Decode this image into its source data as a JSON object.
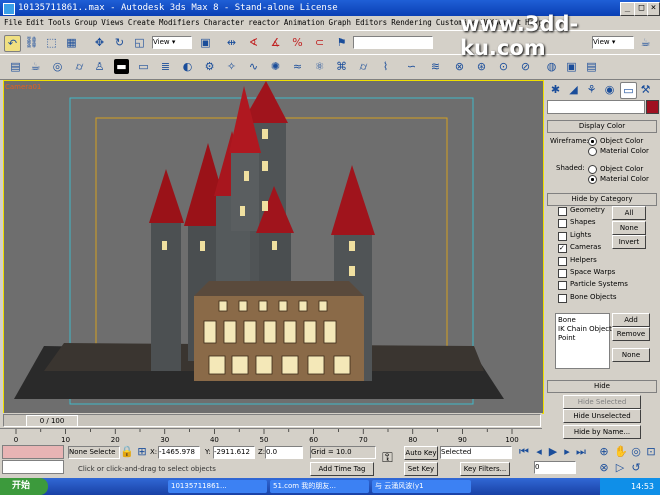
{
  "window": {
    "title": "10135711861..max - Autodesk 3ds Max 8  - Stand-alone License"
  },
  "menu": [
    "File",
    "Edit",
    "Tools",
    "Group",
    "Views",
    "Create",
    "Modifiers",
    "Character",
    "reactor",
    "Animation",
    "Graph Editors",
    "Rendering",
    "Customize",
    "MAXScript",
    "Help"
  ],
  "watermark": "www.3dd-ku.com",
  "toolbar": {
    "view_dropdown": "View",
    "view_dropdown2": "View"
  },
  "viewport": {
    "label": "Camera01"
  },
  "command_panel": {
    "display_color": {
      "header": "Display Color",
      "wireframe_label": "Wireframe:",
      "shaded_label": "Shaded:",
      "object_color": "Object Color",
      "material_color": "Material Color"
    },
    "hide_by_category": {
      "header": "Hide by Category",
      "items": [
        "Geometry",
        "Shapes",
        "Lights",
        "Cameras",
        "Helpers",
        "Space Warps",
        "Particle Systems",
        "Bone Objects"
      ],
      "checked": [
        false,
        false,
        false,
        true,
        false,
        false,
        false,
        false
      ],
      "all_button": "All",
      "none_button": "None",
      "invert_button": "Invert",
      "list": [
        "Bone",
        "IK Chain Object",
        "Point"
      ],
      "add_button": "Add",
      "remove_button": "Remove",
      "none2_button": "None"
    },
    "hide": {
      "header": "Hide",
      "hide_selected": "Hide Selected",
      "hide_unselected": "Hide Unselected",
      "hide_by_name": "Hide by Name..."
    }
  },
  "timeline": {
    "frame_counter": "0 / 100",
    "ticks": [
      "0",
      "10",
      "20",
      "30",
      "40",
      "50",
      "60",
      "70",
      "80",
      "90",
      "100"
    ]
  },
  "status": {
    "selection": "None Selecte",
    "x_label": "X:",
    "x_value": "-1465.978",
    "y_label": "Y:",
    "y_value": "-2911.612",
    "z_label": "Z:",
    "z_value": "0.0",
    "grid": "Grid = 10.0",
    "add_time_tag": "Add Time Tag",
    "prompt": "Click or click-and-drag to select objects",
    "auto_key": "Auto Key",
    "set_key": "Set Key",
    "key_filter_value": "Selected",
    "key_filters": "Key Filters...",
    "frame": "0"
  },
  "taskbar": {
    "start": "开始",
    "tasks": [
      "10135711861...",
      "51.com 我的朋友...",
      "与 云涌风波(y1"
    ],
    "clock": "14:53"
  },
  "colors": {
    "accent": "#0a3fb4",
    "viewport_bg": "#6e6e6e",
    "roof_red": "#a0141c",
    "active_border": "#f0e000"
  }
}
